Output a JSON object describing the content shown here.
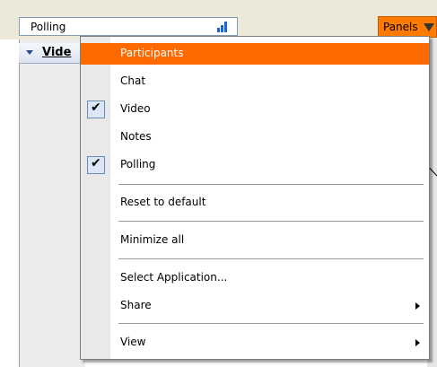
{
  "polling_field": {
    "label": "Polling",
    "icon": "signal-bars-icon"
  },
  "panels_button": {
    "label": "Panels",
    "icon": "dropdown-arrow-icon",
    "color": "#ff7a00"
  },
  "video_header": {
    "label": "Vide"
  },
  "menu": {
    "highlight_color": "#ff6a00",
    "items": [
      {
        "label": "Participants",
        "checked": false,
        "highlighted": true
      },
      {
        "label": "Chat",
        "checked": false
      },
      {
        "label": "Video",
        "checked": true
      },
      {
        "label": "Notes",
        "checked": false
      },
      {
        "label": "Polling",
        "checked": true
      },
      {
        "label": "Reset to default"
      },
      {
        "label": "Minimize all"
      },
      {
        "label": "Select Application..."
      },
      {
        "label": "Share",
        "submenu": true
      },
      {
        "label": "View",
        "submenu": true
      }
    ]
  }
}
